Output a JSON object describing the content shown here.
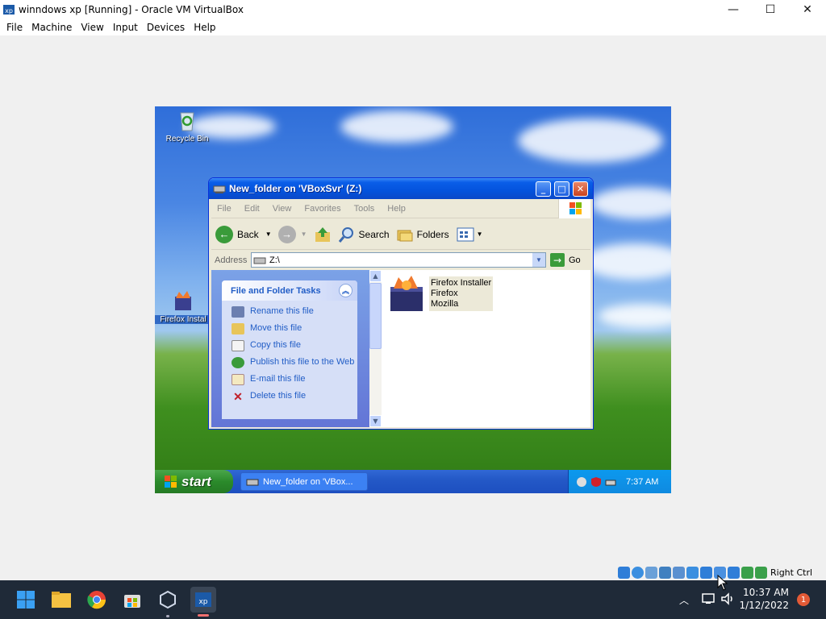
{
  "host": {
    "window_title": "winndows xp [Running] - Oracle VM VirtualBox",
    "menu": [
      "File",
      "Machine",
      "View",
      "Input",
      "Devices",
      "Help"
    ],
    "controls": {
      "minimize": "—",
      "maximize": "☐",
      "close": "✕"
    },
    "status_right_ctrl": "Right Ctrl"
  },
  "guest": {
    "desktop_icons": {
      "recycle_bin": "Recycle Bin",
      "firefox_installer": "Firefox Instal"
    },
    "explorer": {
      "title": "New_folder on 'VBoxSvr' (Z:)",
      "menu": [
        "File",
        "Edit",
        "View",
        "Favorites",
        "Tools",
        "Help"
      ],
      "toolbar": {
        "back": "Back",
        "search": "Search",
        "folders": "Folders"
      },
      "address_label": "Address",
      "address_value": "Z:\\",
      "go_label": "Go",
      "tasks_title": "File and Folder Tasks",
      "tasks": [
        "Rename this file",
        "Move this file",
        "Copy this file",
        "Publish this file to the Web",
        "E-mail this file",
        "Delete this file"
      ],
      "file": {
        "line1": "Firefox Installer",
        "line2": "Firefox",
        "line3": "Mozilla"
      }
    },
    "taskbar": {
      "start": "start",
      "task_button": "New_folder on 'VBox...",
      "time": "7:37 AM"
    }
  },
  "win11": {
    "time": "10:37 AM",
    "date": "1/12/2022",
    "notification_count": "1"
  }
}
